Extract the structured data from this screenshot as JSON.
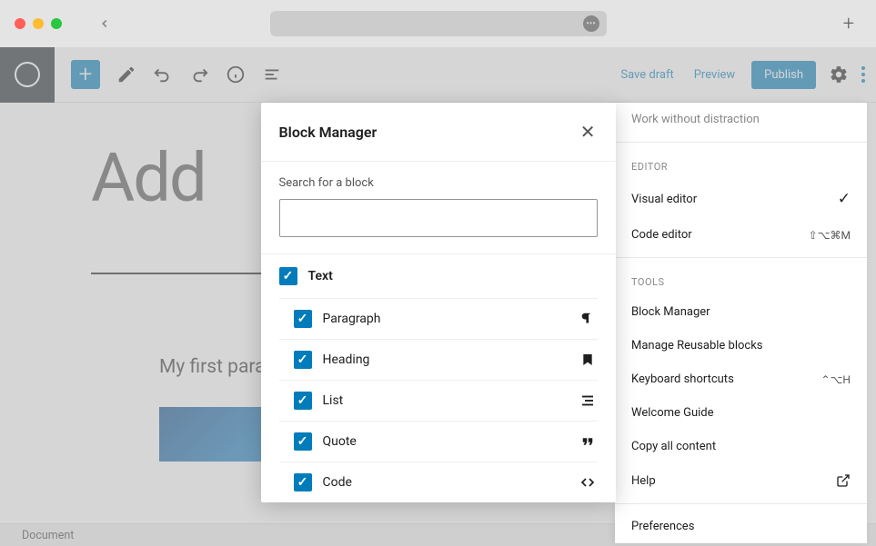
{
  "titlebar": {
    "back_aria": "Back",
    "newtab_aria": "New Tab"
  },
  "toolbar": {
    "save_draft": "Save draft",
    "preview": "Preview",
    "publish": "Publish"
  },
  "editor": {
    "title": "Add",
    "paragraph1": "My first para",
    "status_bar": "Document"
  },
  "sidebar": {
    "work_without_distraction": "Work without distraction",
    "editor_label": "EDITOR",
    "visual_editor": "Visual editor",
    "code_editor": "Code editor",
    "code_shortcut": "⇧⌥⌘M",
    "tools_label": "TOOLS",
    "block_manager": "Block Manager",
    "manage_reusable": "Manage Reusable blocks",
    "keyboard_shortcuts": "Keyboard shortcuts",
    "keyboard_shortcut": "⌃⌥H",
    "welcome_guide": "Welcome Guide",
    "copy_all": "Copy all content",
    "help": "Help",
    "preferences": "Preferences"
  },
  "modal": {
    "title": "Block Manager",
    "search_label": "Search for a block",
    "search_value": "",
    "category": "Text",
    "blocks": [
      {
        "label": "Paragraph",
        "icon": "pilcrow"
      },
      {
        "label": "Heading",
        "icon": "bookmark"
      },
      {
        "label": "List",
        "icon": "list"
      },
      {
        "label": "Quote",
        "icon": "quote"
      },
      {
        "label": "Code",
        "icon": "code"
      }
    ]
  }
}
